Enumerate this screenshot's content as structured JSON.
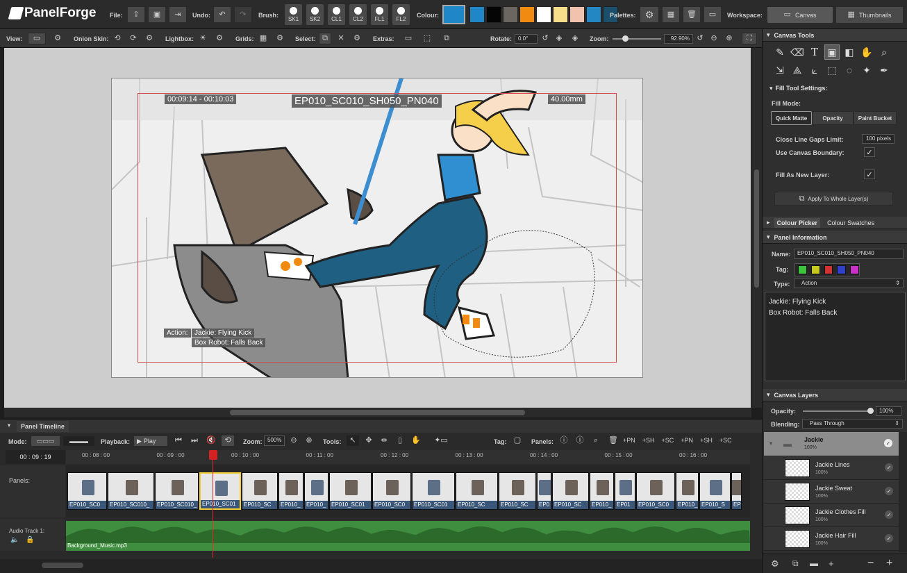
{
  "app": {
    "name": "PanelForge"
  },
  "topbar": {
    "file_label": "File:",
    "undo_label": "Undo:",
    "brush_label": "Brush:",
    "brushes": [
      "SK1",
      "SK2",
      "CL1",
      "CL2",
      "FL1",
      "FL2"
    ],
    "colour_label": "Colour:",
    "swatches": [
      "#1f86c7",
      "#050505",
      "#6c6660",
      "#f08a10",
      "#ffffff",
      "#f7de8a",
      "#f1c2ae",
      "#2387c4",
      "#1c4f6c"
    ],
    "palettes_label": "Palettes:",
    "workspace_label": "Workspace:",
    "workspace_canvas": "Canvas",
    "workspace_thumbnails": "Thumbnails"
  },
  "toolbar2": {
    "view_label": "View:",
    "onion_label": "Onion Skin:",
    "lightbox_label": "Lightbox:",
    "grids_label": "Grids:",
    "select_label": "Select:",
    "extras_label": "Extras:",
    "rotate_label": "Rotate:",
    "rotate_value": "0.0°",
    "zoom_label": "Zoom:",
    "zoom_value": "92.90%",
    "zoom_fraction": 0.25
  },
  "canvas": {
    "timecode": "00:09:14 - 00:10:03",
    "shot_name": "EP010_SC010_SH050_PN040",
    "measure": "40.00mm",
    "action_label": "Action:",
    "action_line1": "Jackie: Flying Kick",
    "action_line2": "Box Robot: Falls Back"
  },
  "right_panel": {
    "canvas_tools_title": "Canvas Tools",
    "fill_settings_title": "Fill Tool Settings:",
    "fill_mode_label": "Fill Mode:",
    "fill_modes": [
      "Quick Matte",
      "Opacity",
      "Paint Bucket"
    ],
    "close_gaps_label": "Close Line Gaps Limit:",
    "close_gaps_value": "100 pixels",
    "canvas_boundary_label": "Use Canvas Boundary:",
    "fill_new_layer_label": "Fill As New Layer:",
    "apply_button": "Apply To Whole Layer(s)",
    "colour_picker_tab": "Colour Picker",
    "colour_swatches_tab": "Colour Swatches",
    "panel_info_title": "Panel Information",
    "name_label": "Name:",
    "name_value": "EP010_SC010_SH050_PN040",
    "tag_label": "Tag:",
    "tag_colors": [
      "#3cc43c",
      "#c8c81e",
      "#d23232",
      "#3040c8",
      "#c832c8"
    ],
    "type_label": "Type:",
    "type_value": "Action",
    "notes_line1": "Jackie: Flying Kick",
    "notes_line2": "Box Robot: Falls Back",
    "canvas_layers_title": "Canvas Layers",
    "opacity_label": "Opacity:",
    "opacity_value": "100%",
    "opacity_fraction": 1.0,
    "blending_label": "Blending:",
    "blending_value": "Pass Through",
    "group_name": "Jackie",
    "group_opacity": "100%",
    "layers": [
      {
        "name": "Jackie Lines",
        "opacity": "100%"
      },
      {
        "name": "Jackie Sweat",
        "opacity": "100%"
      },
      {
        "name": "Jackie Clothes Fill",
        "opacity": "100%"
      },
      {
        "name": "Jackie Hair Fill",
        "opacity": "100%"
      }
    ]
  },
  "timeline": {
    "title": "Panel Timeline",
    "mode_label": "Mode:",
    "playback_label": "Playback:",
    "play_label": "Play",
    "zoom_label": "Zoom:",
    "zoom_value": "500%",
    "tools_label": "Tools:",
    "tag_label": "Tag:",
    "panels_label": "Panels:",
    "pn_button": "+PN",
    "sh_button": "+SH",
    "sc_button": "+SC",
    "current_time": "00 : 09 : 19",
    "ticks": [
      "00 : 08 : 00",
      "00 : 09 : 00",
      "00 : 10 : 00",
      "00 : 11 : 00",
      "00 : 12 : 00",
      "00 : 13 : 00",
      "00 : 14 : 00",
      "00 : 15 : 00",
      "00 : 16 : 00"
    ],
    "panels_row_label": "Panels:",
    "panel_captions": [
      "EP010_SC0",
      "EP010_SC010_",
      "EP010_SC010_",
      "EP010_SC01",
      "EP010_SC",
      "EP010_",
      "EP010_",
      "EP010_SC01",
      "EP010_SC0",
      "EP010_SC01",
      "EP010_SC",
      "EP010_SC",
      "EP0",
      "EP010_SC",
      "EP010_",
      "EP01",
      "EP010_SC0",
      "EP010_",
      "EP010_S",
      "EP0"
    ],
    "audio_label": "Audio Track 1:",
    "audio_file": "Background_Music.mp3"
  }
}
